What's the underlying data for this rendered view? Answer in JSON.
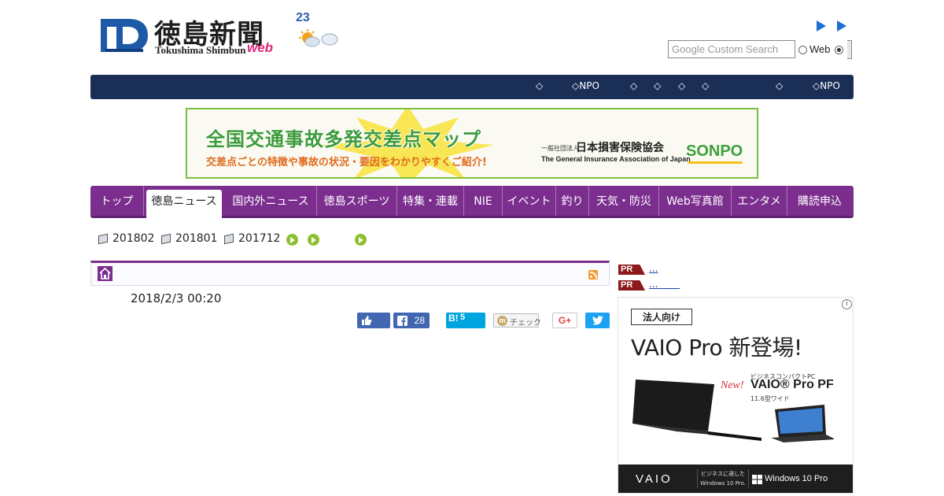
{
  "header": {
    "logo_title": "徳島新聞",
    "logo_subtitle": "Tokushima Shimbun",
    "logo_web": "web",
    "weather_temp": "23",
    "search_placeholder": "Google Custom Search",
    "search_option_web": "Web"
  },
  "dark_nav": {
    "items": [
      "◇",
      "◇NPO",
      "◇",
      "◇",
      "◇",
      "◇",
      "◇",
      "◇NPO"
    ]
  },
  "banner": {
    "headline": "全国交通事故多発交差点マップ",
    "subline": "交差点ごとの特徴や事故の状況・要因をわかりやすくご紹介!",
    "org_prefix": "一般社団法人",
    "org_name": "日本損害保険協会",
    "org_english": "The General Insurance Association of Japan",
    "brand": "SONPO"
  },
  "main_nav": {
    "tabs": [
      "トップ",
      "徳島ニュース",
      "国内外ニュース",
      "徳島スポーツ",
      "特集・連載",
      "NIE",
      "イベント",
      "釣り",
      "天気・防災",
      "Web写真館",
      "エンタメ",
      "購読申込"
    ],
    "active_index": 1
  },
  "archive": {
    "months": [
      "201802",
      "201801",
      "201712"
    ]
  },
  "article": {
    "date": "2018/2/3 00:20"
  },
  "share": {
    "facebook_count": "28",
    "hatena_label": "B!",
    "hatena_count": "5",
    "mixi_label": "チェック",
    "gplus_label": "G+"
  },
  "sidebar": {
    "pr_items": [
      {
        "tag": "PR",
        "text": "..."
      },
      {
        "tag": "PR",
        "text": "... "
      }
    ],
    "ad": {
      "badge": "法人向け",
      "headline": "VAIO Pro 新登場!",
      "subtitle_small": "ビジネスコンパクトPC",
      "new_label": "New!",
      "model": "VAIO® Pro PF",
      "size": "11.6型ワイド",
      "brand": "VAIO",
      "suits": "ビジネスに適した Windows 10 Pro.",
      "windows": "Windows 10 Pro"
    }
  },
  "colors": {
    "dark_nav": "#1a2e56",
    "main_nav": "#7b2e8e",
    "banner_green": "#3c9b3a",
    "banner_orange": "#e06a1e",
    "pr_tag": "#8c1a1a"
  }
}
